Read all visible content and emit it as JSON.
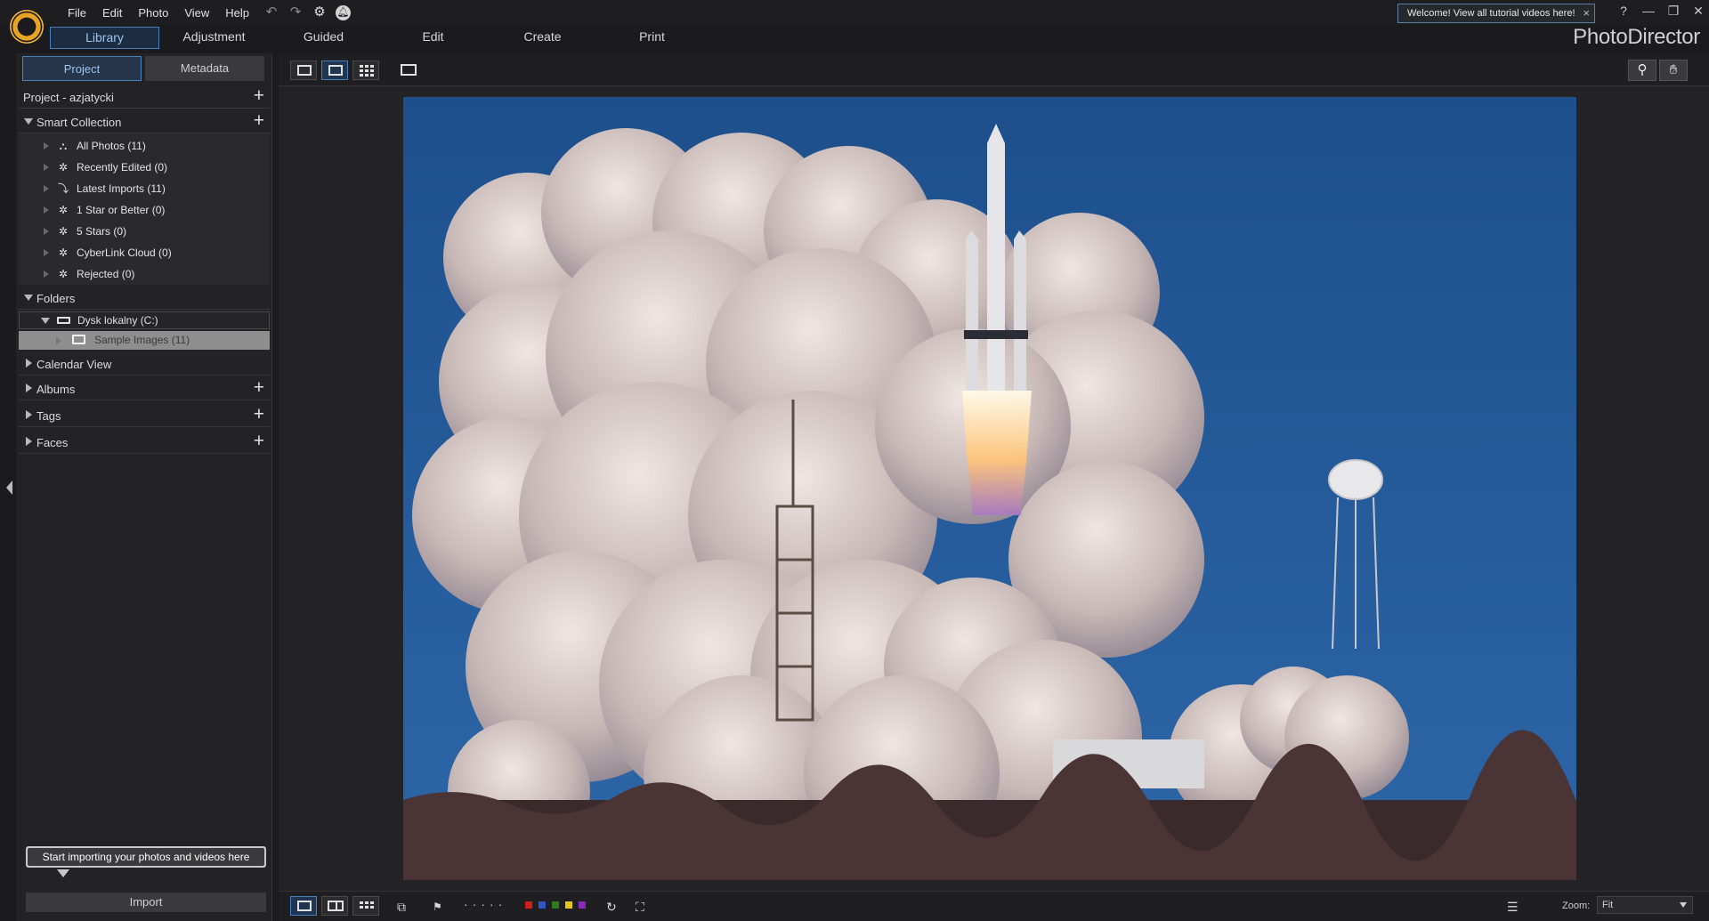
{
  "menu": [
    "File",
    "Edit",
    "Photo",
    "View",
    "Help"
  ],
  "welcome_text": "Welcome! View all tutorial videos here!",
  "modules": [
    "Library",
    "Adjustment",
    "Guided",
    "Edit",
    "Create",
    "Print"
  ],
  "brand": "PhotoDirector",
  "panel_tabs": [
    "Project",
    "Metadata"
  ],
  "project_label": "Project - azjatycki",
  "smart_collection": {
    "title": "Smart Collection",
    "items": [
      {
        "label": "All Photos (11)",
        "icon": "all-photos-icon"
      },
      {
        "label": "Recently Edited (0)",
        "icon": "smart-collection-icon"
      },
      {
        "label": "Latest Imports (11)",
        "icon": "latest-imports-icon"
      },
      {
        "label": "1 Star or Better (0)",
        "icon": "smart-collection-icon"
      },
      {
        "label": "5 Stars (0)",
        "icon": "smart-collection-icon"
      },
      {
        "label": "CyberLink Cloud (0)",
        "icon": "smart-collection-icon"
      },
      {
        "label": "Rejected (0)",
        "icon": "smart-collection-icon"
      }
    ]
  },
  "folders": {
    "title": "Folders",
    "drive": "Dysk lokalny (C:)",
    "folder": "Sample Images (11)"
  },
  "sections": [
    "Calendar View",
    "Albums",
    "Tags",
    "Faces"
  ],
  "tooltip": "Start importing your photos and videos here",
  "import_label": "Import",
  "zoom_label": "Zoom:",
  "zoom_value": "Fit",
  "color_labels": [
    "#d0201d",
    "#2e58c8",
    "#2f7a1f",
    "#e8c31a",
    "#8a2ab8"
  ],
  "accent_color": "#4a7fbd"
}
